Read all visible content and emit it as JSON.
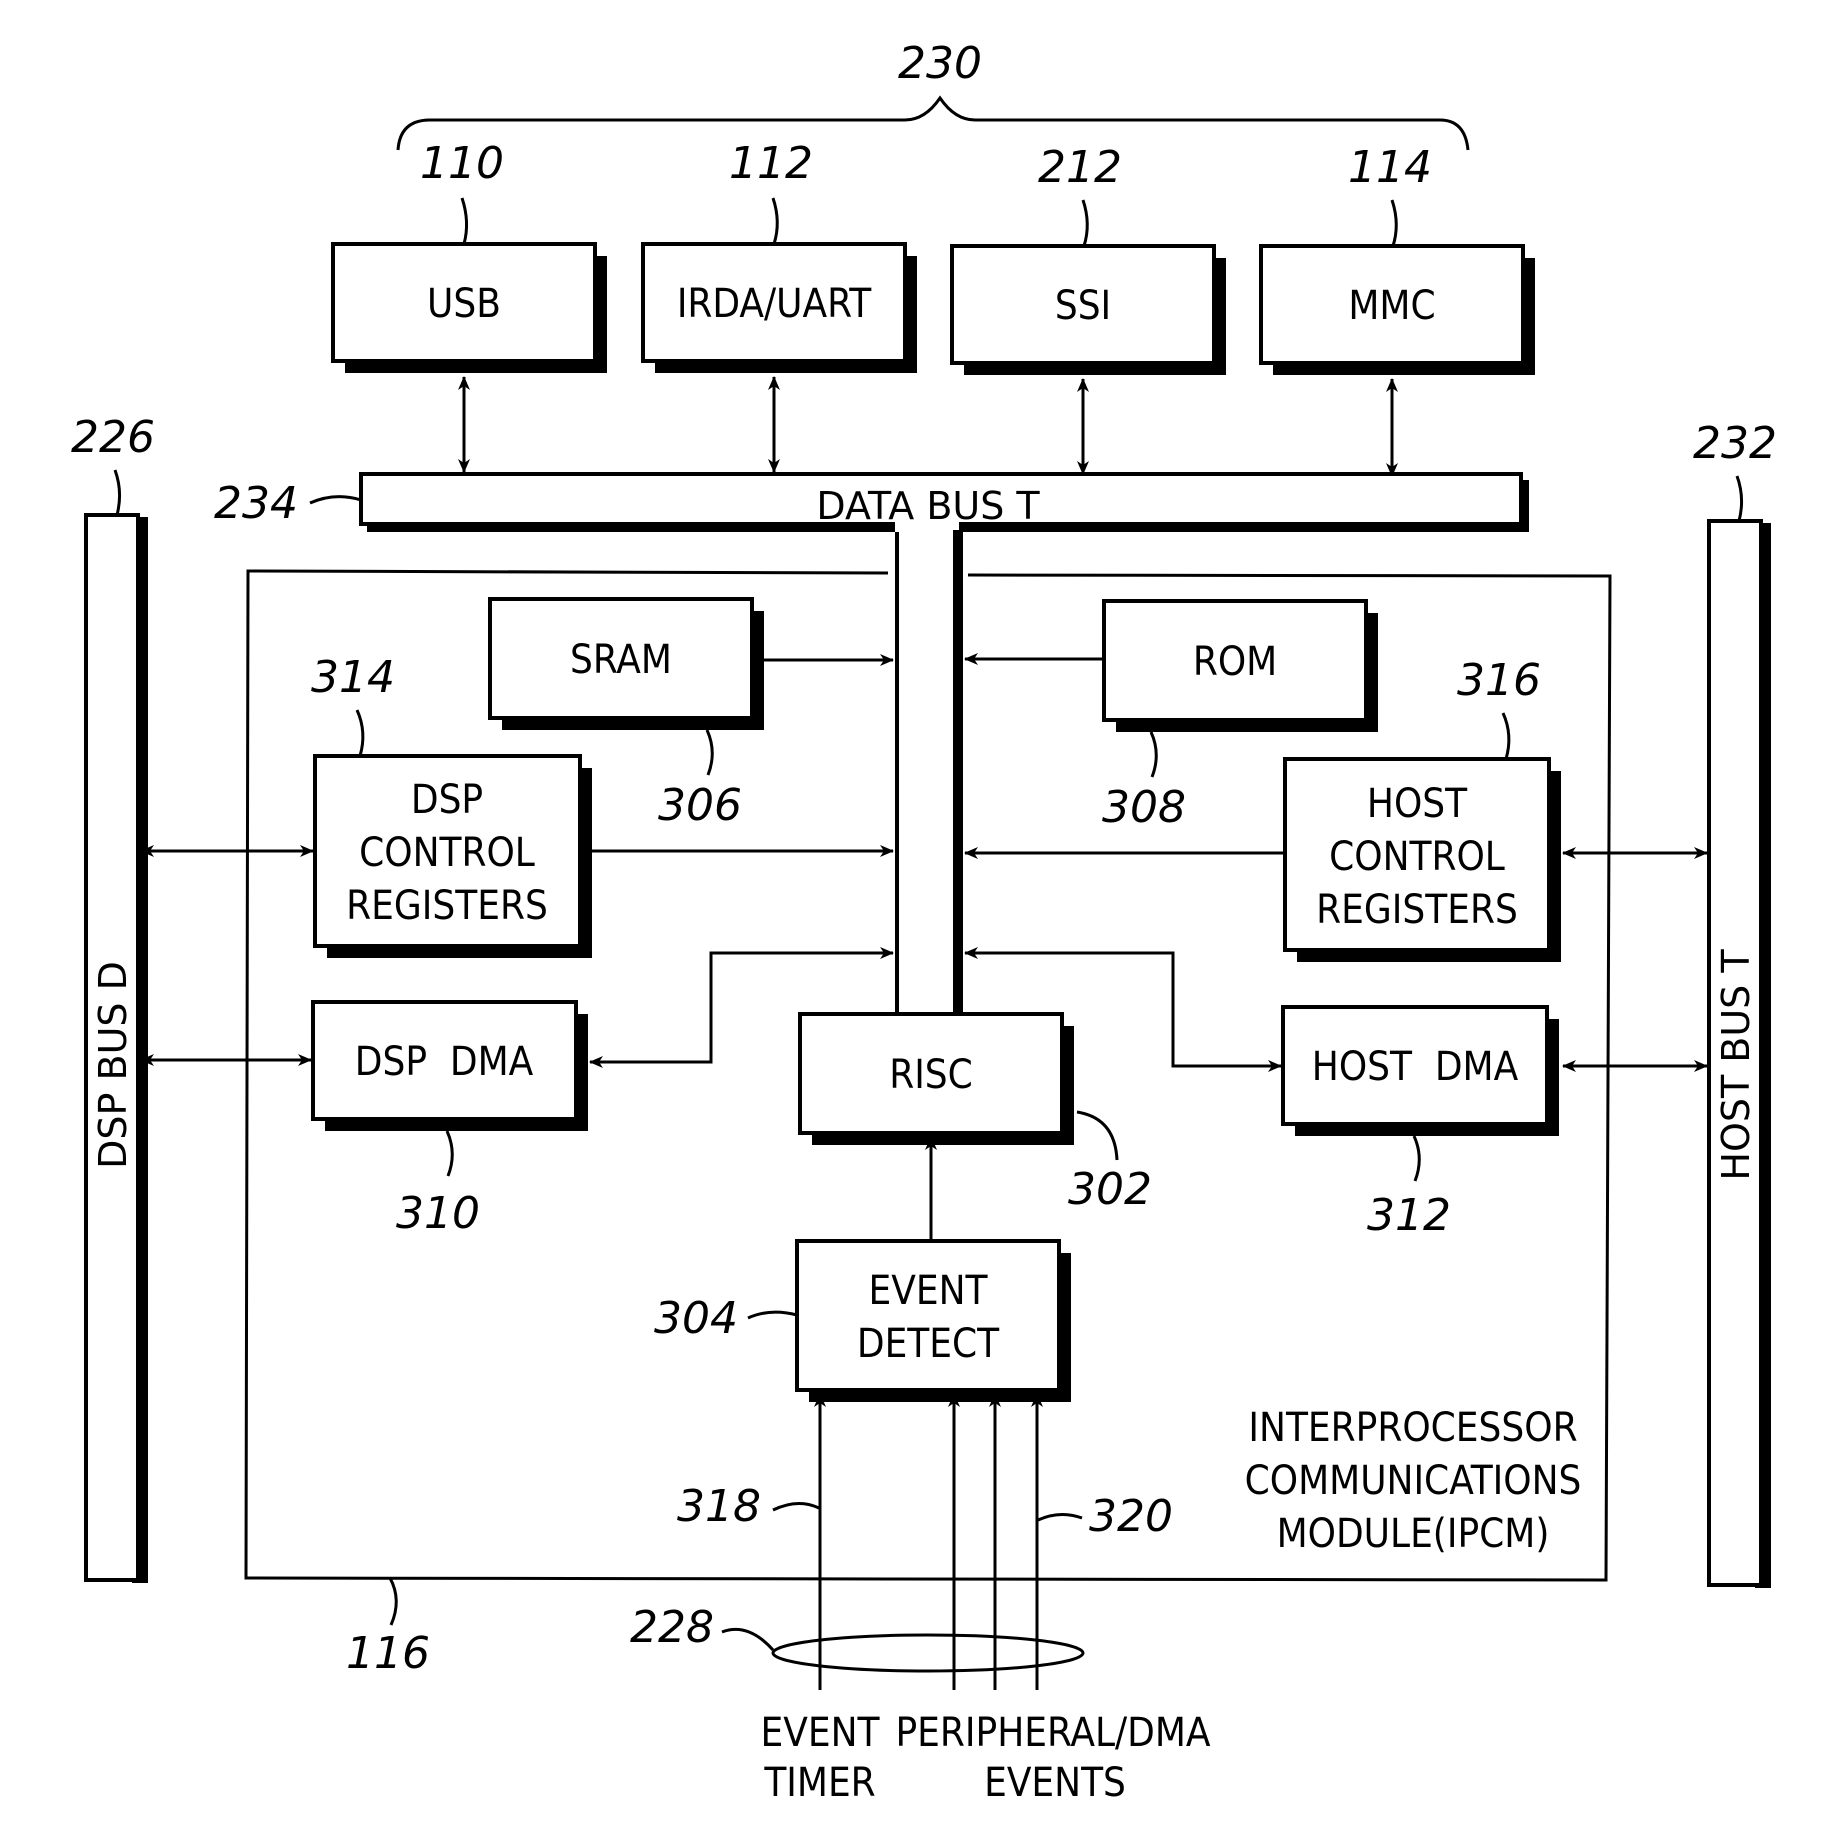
{
  "diagram": {
    "group_label": "230",
    "data_bus": {
      "label": "DATA BUS T",
      "ref": "234"
    },
    "dsp_bus": {
      "label": "DSP BUS D",
      "ref": "226"
    },
    "host_bus": {
      "label": "HOST BUS T",
      "ref": "232"
    },
    "peripherals": [
      {
        "label": "USB",
        "ref": "110"
      },
      {
        "label": "IRDA/UART",
        "ref": "112"
      },
      {
        "label": "SSI",
        "ref": "212"
      },
      {
        "label": "MMC",
        "ref": "114"
      }
    ],
    "blocks": {
      "sram": {
        "label": "SRAM",
        "ref": "306"
      },
      "rom": {
        "label": "ROM",
        "ref": "308"
      },
      "dsp_ctrl": {
        "lines": [
          "DSP",
          "CONTROL",
          "REGISTERS"
        ],
        "ref": "314"
      },
      "host_ctrl": {
        "lines": [
          "HOST",
          "CONTROL",
          "REGISTERS"
        ],
        "ref": "316"
      },
      "dsp_dma": {
        "label": "DSP  DMA",
        "ref": "310"
      },
      "host_dma": {
        "label": "HOST  DMA",
        "ref": "312"
      },
      "risc": {
        "label": "RISC",
        "ref": "302"
      },
      "event_detect": {
        "lines": [
          "EVENT",
          "DETECT"
        ],
        "ref": "304"
      }
    },
    "ipcm": {
      "lines": [
        "INTERPROCESSOR",
        "COMMUNICATIONS",
        "MODULE(IPCM)"
      ],
      "ref": "116"
    },
    "inputs": {
      "timer_ref": "318",
      "peripheral_ref": "320",
      "bundle_ref": "228",
      "timer_label": [
        "EVENT",
        "TIMER"
      ],
      "peripheral_label": [
        "PERIPHERAL/DMA",
        "EVENTS"
      ]
    }
  }
}
